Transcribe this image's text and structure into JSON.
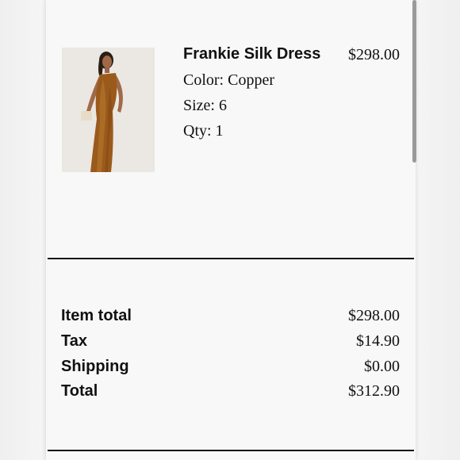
{
  "cart_item": {
    "name": "Frankie Silk Dress",
    "price": "$298.00",
    "color_line": "Color: Copper",
    "size_line": "Size: 6",
    "qty_line": "Qty: 1"
  },
  "summary": {
    "item_total_label": "Item total",
    "item_total_value": "$298.00",
    "tax_label": "Tax",
    "tax_value": "$14.90",
    "shipping_label": "Shipping",
    "shipping_value": "$0.00",
    "total_label": "Total",
    "total_value": "$312.90"
  }
}
